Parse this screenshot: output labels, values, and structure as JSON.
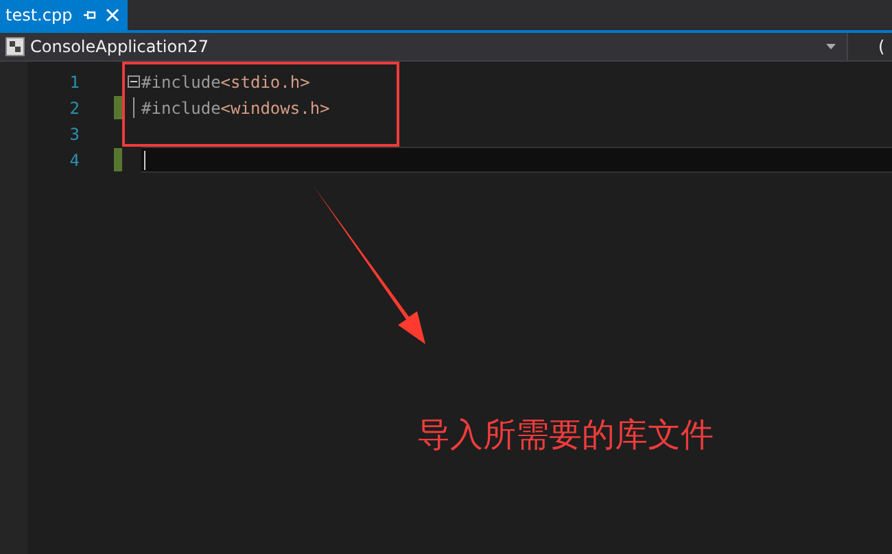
{
  "tab": {
    "label": "test.cpp",
    "selected": true
  },
  "nav": {
    "project": "ConsoleApplication27",
    "scope": "("
  },
  "lines": [
    {
      "number": "1",
      "directive": "#include",
      "header": "<stdio.h>",
      "changed": false,
      "current": false,
      "foldable": true
    },
    {
      "number": "2",
      "directive": "#include",
      "header": "<windows.h>",
      "changed": true,
      "current": false,
      "foldable": false
    },
    {
      "number": "3",
      "changed": false,
      "current": false,
      "foldable": false
    },
    {
      "number": "4",
      "changed": true,
      "current": true,
      "foldable": false
    }
  ],
  "annotation": {
    "caption": "导入所需要的库文件"
  }
}
